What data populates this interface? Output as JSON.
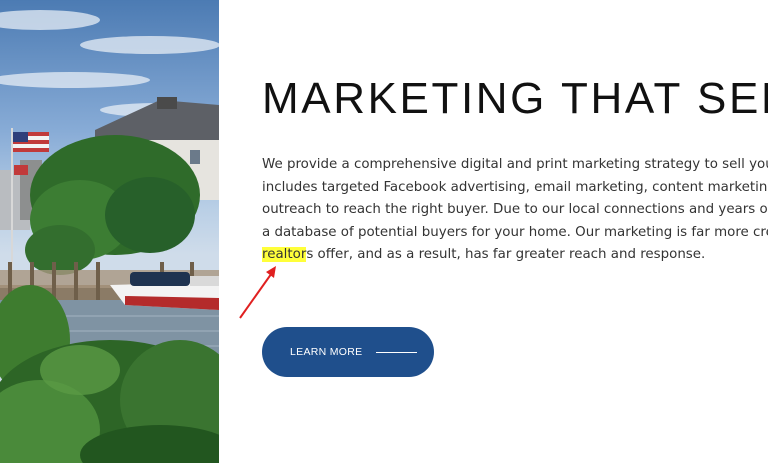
{
  "hero": {
    "title": "MARKETING THAT SELLS",
    "body_lines": [
      "We provide a comprehensive digital and print marketing strategy to sell your home, which",
      "includes targeted Facebook advertising, email marketing, content marketing, and personal",
      "outreach to reach the right buyer. Due to our local connections and years of experience, we have",
      "a database of potential buyers for your home. Our marketing is far more creative than what other"
    ],
    "last_line_highlight": "realtor",
    "last_line_rest": "s offer, and as a result, has far greater reach and response.",
    "highlight_color": "#ffff3a"
  },
  "cta": {
    "label": "LEARN MORE",
    "color": "#1f4f8c"
  },
  "annotation": {
    "arrow_color": "#e02020"
  },
  "photo": {
    "description_icon": "harbor-photo"
  }
}
